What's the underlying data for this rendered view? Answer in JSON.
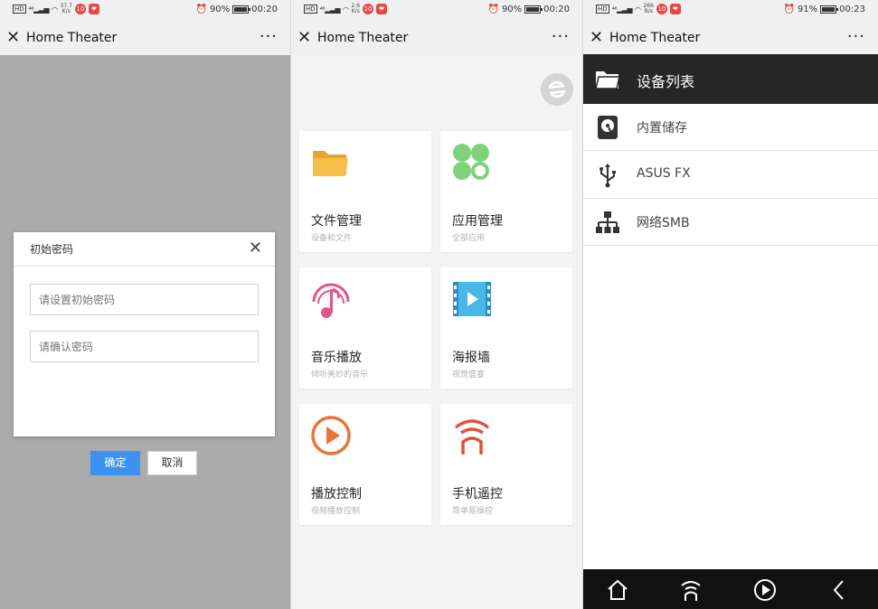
{
  "screens": [
    {
      "status": {
        "net_speed_top": "37.7",
        "net_speed_bottom": "K/s",
        "badge1": "10",
        "badge2": "❤",
        "battery": "90%",
        "battery_level": 0.9,
        "time": "00:20"
      },
      "title": "Home Theater",
      "more": "···",
      "close": "✕"
    },
    {
      "status": {
        "net_speed_top": "2.6",
        "net_speed_bottom": "K/s",
        "badge1": "10",
        "badge2": "❤",
        "battery": "90%",
        "battery_level": 0.9,
        "time": "00:20"
      },
      "title": "Home Theater",
      "more": "···",
      "close": "✕"
    },
    {
      "status": {
        "net_speed_top": "266",
        "net_speed_bottom": "B/s",
        "badge1": "10",
        "badge2": "❤",
        "battery": "91%",
        "battery_level": 0.91,
        "time": "00:23"
      },
      "title": "Home Theater",
      "more": "···",
      "close": "✕"
    }
  ],
  "dialog": {
    "title": "初始密码",
    "close": "✕",
    "password_placeholder": "请设置初始密码",
    "confirm_placeholder": "请确认密码",
    "ok_label": "确定",
    "cancel_label": "取消"
  },
  "home": {
    "cards": [
      {
        "title": "文件管理",
        "subtitle": "设备和文件",
        "icon": "folder-icon",
        "color": "#f0b43a"
      },
      {
        "title": "应用管理",
        "subtitle": "全部应用",
        "icon": "clover-icon",
        "color": "#7ed27a"
      },
      {
        "title": "音乐播放",
        "subtitle": "倾听美妙的音乐",
        "icon": "music-icon",
        "color": "#e2558a"
      },
      {
        "title": "海报墙",
        "subtitle": "视觉盛宴",
        "icon": "film-icon",
        "color": "#49b7e9"
      },
      {
        "title": "播放控制",
        "subtitle": "视频播放控制",
        "icon": "play-icon",
        "color": "#e8743a"
      },
      {
        "title": "手机遥控",
        "subtitle": "简单易操控",
        "icon": "remote-icon",
        "color": "#e0503e"
      }
    ]
  },
  "devices": {
    "header": "设备列表",
    "items": [
      {
        "label": "内置储存",
        "icon": "hard-drive-icon"
      },
      {
        "label": "ASUS FX",
        "icon": "usb-icon"
      },
      {
        "label": "网络SMB",
        "icon": "network-icon"
      }
    ]
  },
  "bottom_nav": [
    "home-icon",
    "remote-icon",
    "play-icon",
    "back-icon"
  ]
}
